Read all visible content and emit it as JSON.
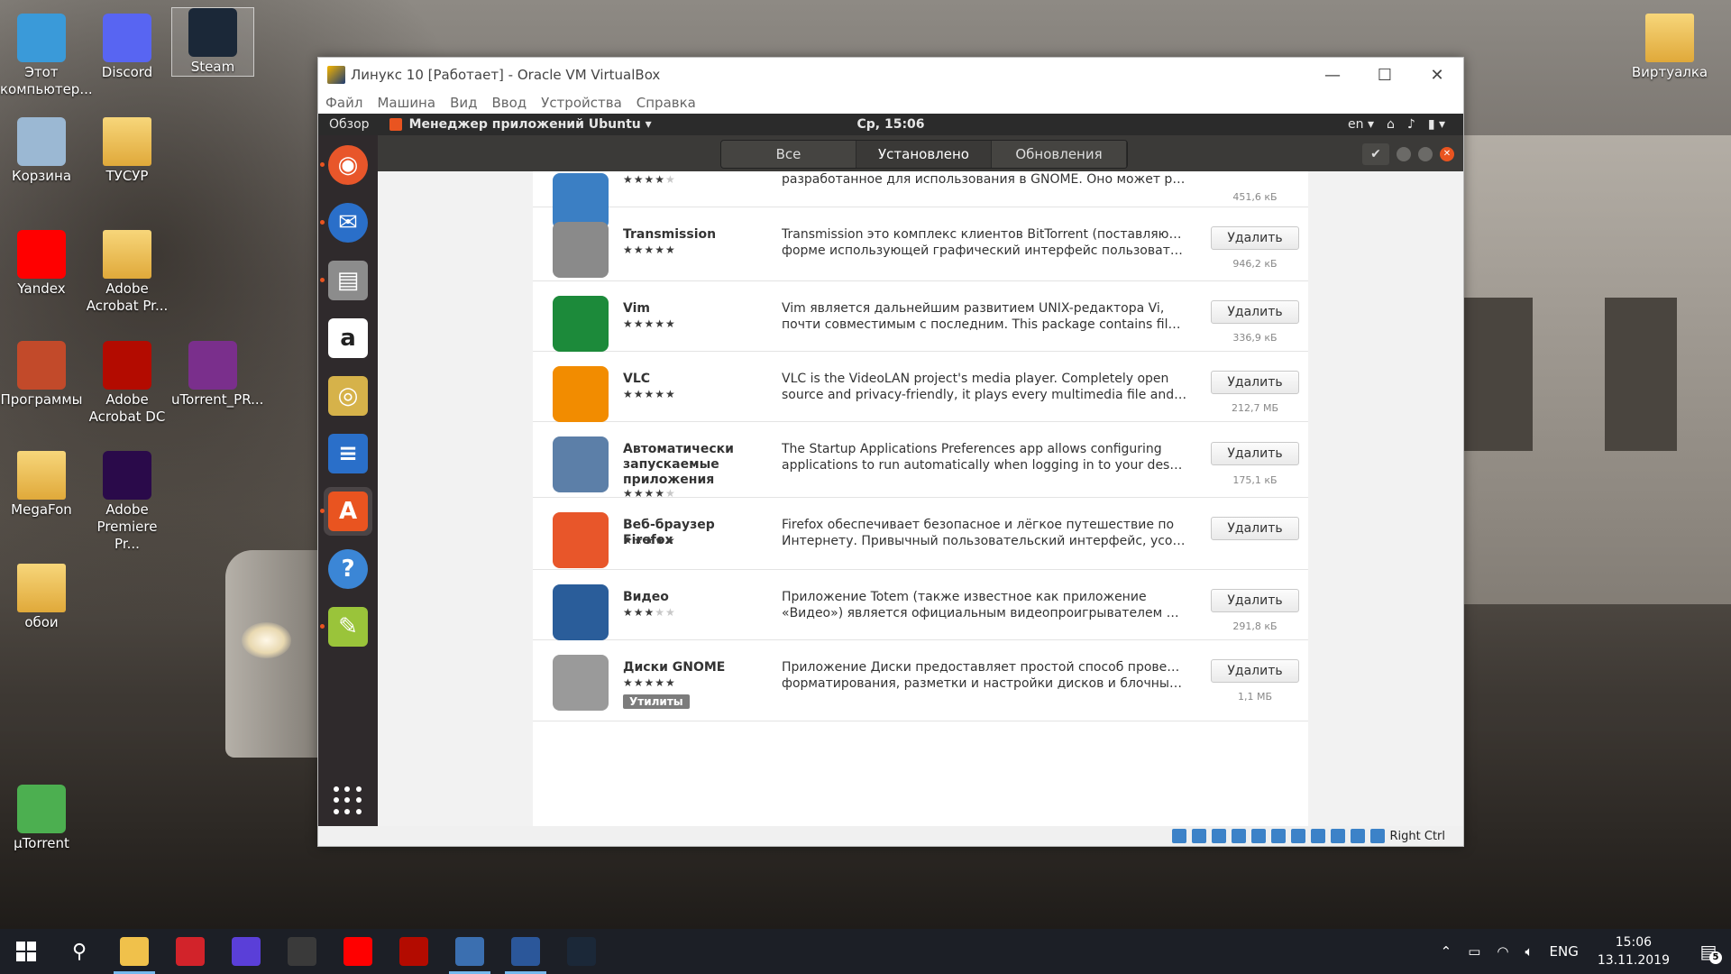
{
  "desktop": {
    "icons": [
      {
        "label": "Этот компьютер...",
        "icon": "computer-icon",
        "color": "#3a9ad9"
      },
      {
        "label": "Discord",
        "icon": "discord-icon",
        "color": "#5865f2"
      },
      {
        "label": "Steam",
        "icon": "steam-icon",
        "color": "#1b2838"
      },
      {
        "label": "Корзина",
        "icon": "recycle-bin-icon",
        "color": "#9bb8d3"
      },
      {
        "label": "ТУСУР",
        "icon": "folder-icon",
        "color": "#e8b84a"
      },
      {
        "label": "Yandex",
        "icon": "yandex-icon",
        "color": "#ff0000"
      },
      {
        "label": "Adobe Acrobat Pr...",
        "icon": "folder-icon",
        "color": "#e8b84a"
      },
      {
        "label": "Программы",
        "icon": "programs-icon",
        "color": "#c24a2a"
      },
      {
        "label": "Adobe Acrobat DC",
        "icon": "acrobat-icon",
        "color": "#b30b00"
      },
      {
        "label": "uTorrent_PR...",
        "icon": "winrar-icon",
        "color": "#7a2f8c"
      },
      {
        "label": "MegaFon",
        "icon": "folder-icon",
        "color": "#e8b84a"
      },
      {
        "label": "Adobe Premiere Pr...",
        "icon": "premiere-icon",
        "color": "#2a0a4a"
      },
      {
        "label": "обои",
        "icon": "folder-icon",
        "color": "#e8b84a"
      },
      {
        "label": "µTorrent",
        "icon": "utorrent-icon",
        "color": "#4caf50"
      },
      {
        "label": "Виртуалка",
        "icon": "folder-icon",
        "color": "#e8b84a"
      }
    ]
  },
  "vbox": {
    "title": "Линукс 10 [Работает] - Oracle VM VirtualBox",
    "menu": [
      "Файл",
      "Машина",
      "Вид",
      "Ввод",
      "Устройства",
      "Справка"
    ],
    "status_hostkey": "Right Ctrl"
  },
  "ubuntu": {
    "overview": "Обзор",
    "app_name": "Менеджер приложений Ubuntu",
    "clock": "Ср, 15:06",
    "lang": "en",
    "tabs": [
      "Все",
      "Установлено",
      "Обновления"
    ],
    "check": "✔"
  },
  "apps": [
    {
      "name": "",
      "stars": 4,
      "desc1": "разработанное для использования в GNOME. Оно может рас...",
      "desc2": "",
      "button": "",
      "size": "451,6 кБ",
      "color": "#3b7fc4",
      "icon": "checkbox-app-icon"
    },
    {
      "name": "Transmission",
      "stars": 5,
      "desc1": "Transmission это комплекс клиентов BitTorrent (поставляются в",
      "desc2": "форме использующей графический интерфейс пользователя...",
      "button": "Удалить",
      "size": "946,2 кБ",
      "color": "#8a8a8a",
      "icon": "transmission-icon"
    },
    {
      "name": "Vim",
      "stars": 5,
      "desc1": "Vim является дальнейшим развитием UNIX-редактора Vi,",
      "desc2": "почти совместимым с последним.  This package contains files s...",
      "button": "Удалить",
      "size": "336,9 кБ",
      "color": "#1c8a3a",
      "icon": "vim-icon"
    },
    {
      "name": "VLC",
      "stars": 5,
      "desc1": "VLC is the VideoLAN project's media player.  Completely open",
      "desc2": "source and privacy-friendly, it plays every multimedia file and str...",
      "button": "Удалить",
      "size": "212,7 МБ",
      "color": "#f28c00",
      "icon": "vlc-icon"
    },
    {
      "name": "Автоматически запускаемые приложения",
      "stars": 4,
      "desc1": "The Startup Applications Preferences app allows configuring",
      "desc2": "applications to run automatically when logging in to your deskto...",
      "button": "Удалить",
      "size": "175,1 кБ",
      "color": "#5c7fa8",
      "icon": "startup-apps-icon"
    },
    {
      "name": "Веб-браузер Firefox",
      "stars": 5,
      "desc1": "Firefox обеспечивает безопасное и лёгкое путешествие по",
      "desc2": "Интернету. Привычный пользовательский интерфейс, усовер...",
      "button": "Удалить",
      "size": "",
      "color": "#e8562a",
      "icon": "firefox-icon"
    },
    {
      "name": "Видео",
      "stars": 3,
      "desc1": "Приложение Totem (также известное как приложение",
      "desc2": "«Видео») является официальным видеопроигрывателем для...",
      "button": "Удалить",
      "size": "291,8 кБ",
      "color": "#2a5d9a",
      "icon": "totem-icon"
    },
    {
      "name": "Диски GNOME",
      "stars": 5,
      "desc1": "Приложение Диски предоставляет простой способ проверки,",
      "desc2": "форматирования, разметки и настройки дисков и блочных у...",
      "button": "Удалить",
      "size": "1,1 МБ",
      "color": "#9a9a9a",
      "icon": "disks-icon",
      "tag": "Утилиты"
    }
  ],
  "dock": [
    {
      "name": "firefox",
      "icon": "firefox-icon",
      "color": "#e8562a",
      "glyph": "◉",
      "running": true
    },
    {
      "name": "thunderbird",
      "icon": "thunderbird-icon",
      "color": "#2a6fc9",
      "glyph": "✉",
      "running": true
    },
    {
      "name": "files",
      "icon": "files-icon",
      "color": "#8c8c8c",
      "glyph": "▤",
      "running": true
    },
    {
      "name": "amazon",
      "icon": "amazon-icon",
      "color": "#ffffff",
      "glyph": "a",
      "running": false
    },
    {
      "name": "rhythmbox",
      "icon": "rhythmbox-icon",
      "color": "#d6b24a",
      "glyph": "◎",
      "running": false
    },
    {
      "name": "writer",
      "icon": "writer-icon",
      "color": "#2a6fc9",
      "glyph": "≡",
      "running": false
    },
    {
      "name": "software",
      "icon": "software-center-icon",
      "color": "#e95420",
      "glyph": "A",
      "running": true
    },
    {
      "name": "help",
      "icon": "help-icon",
      "color": "#3b86d6",
      "glyph": "?",
      "running": false
    },
    {
      "name": "monitor",
      "icon": "system-monitor-icon",
      "color": "#9ac43a",
      "glyph": "✎",
      "running": true
    }
  ],
  "taskbar": {
    "apps": [
      {
        "icon": "file-explorer-icon",
        "color": "#f0c14b",
        "open": true
      },
      {
        "icon": "game-center-icon",
        "color": "#d2232a",
        "open": false
      },
      {
        "icon": "browser-icon",
        "color": "#5a3fd8",
        "open": false
      },
      {
        "icon": "notion-icon",
        "color": "#3a3a3a",
        "open": false
      },
      {
        "icon": "yandex-icon",
        "color": "#ff0000",
        "open": false
      },
      {
        "icon": "acrobat-icon",
        "color": "#b30b00",
        "open": false
      },
      {
        "icon": "virtualbox-icon",
        "color": "#3b6fb0",
        "open": true
      },
      {
        "icon": "word-icon",
        "color": "#2b579a",
        "open": true
      },
      {
        "icon": "steam-icon",
        "color": "#1b2838",
        "open": false
      }
    ],
    "lang": "ENG",
    "time": "15:06",
    "date": "13.11.2019",
    "notifications": "5"
  }
}
